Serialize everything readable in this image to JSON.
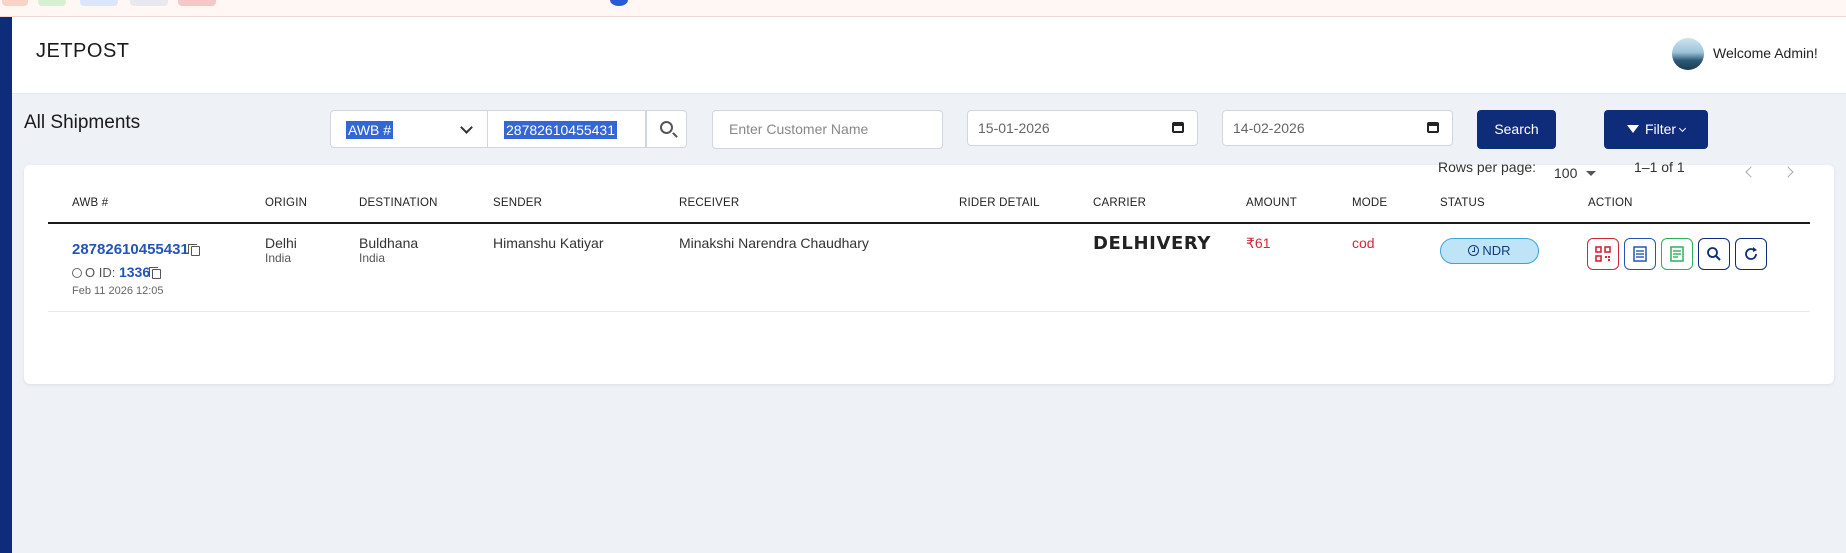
{
  "header": {
    "brand": "JETPOST",
    "welcome": "Welcome Admin!"
  },
  "toolbar": {
    "page_title": "All Shipments",
    "awb_type": "AWB #",
    "awb_value": "28782610455431",
    "customer_placeholder": "Enter Customer Name",
    "date_from": "15-01-2026",
    "date_to": "14-02-2026",
    "search_label": "Search",
    "filter_label": "Filter"
  },
  "table": {
    "columns": [
      "AWB #",
      "ORIGIN",
      "DESTINATION",
      "SENDER",
      "RECEIVER",
      "RIDER DETAIL",
      "CARRIER",
      "AMOUNT",
      "MODE",
      "STATUS",
      "ACTION"
    ],
    "rows": [
      {
        "awb": "28782610455431",
        "order_id_label": "O ID:",
        "order_id": "1336",
        "date": "Feb 11 2026 12:05",
        "origin_city": "Delhi",
        "origin_country": "India",
        "dest_city": "Buldhana",
        "dest_country": "India",
        "sender": "Himanshu Katiyar",
        "receiver": "Minakshi Narendra Chaudhary",
        "rider": "",
        "carrier": "DELHIVERY",
        "amount": "₹61",
        "mode": "cod",
        "status": "NDR"
      }
    ]
  },
  "pagination": {
    "rows_label": "Rows per page:",
    "rows_value": "100",
    "range": "1–1 of 1"
  },
  "colors": {
    "navy": "#0f2c7a",
    "link": "#2454b8",
    "red": "#d0283a",
    "badge_bg": "#bfe4f8",
    "green": "#2eaf5c"
  },
  "icons": [
    "qr-code-icon",
    "invoice-icon",
    "label-icon",
    "search-icon",
    "refresh-icon"
  ]
}
